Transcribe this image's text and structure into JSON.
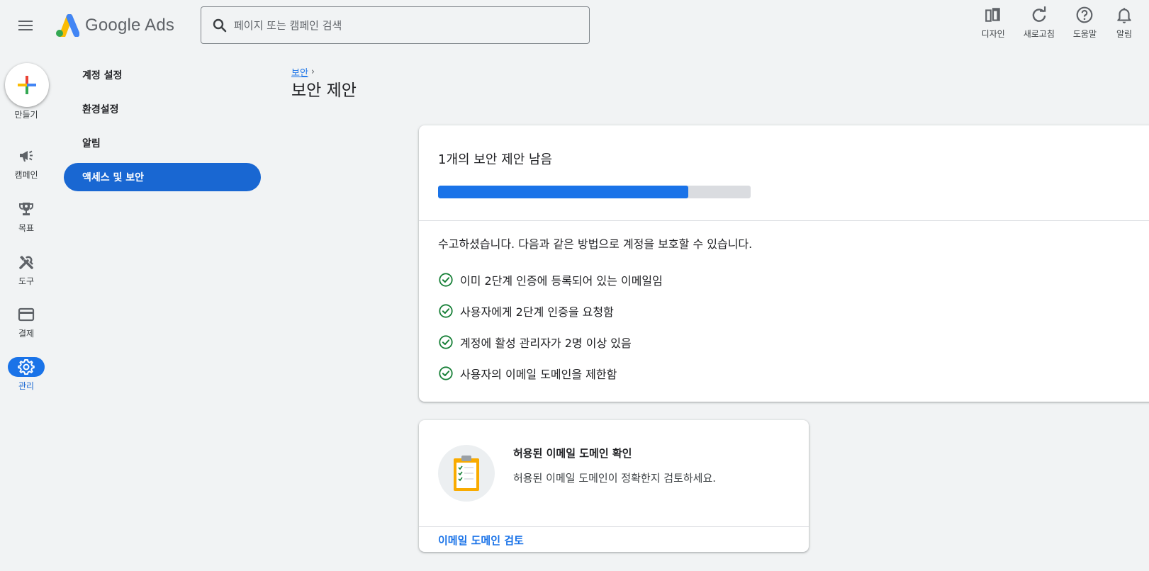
{
  "header": {
    "logo_text": "Google Ads",
    "search_placeholder": "페이지 또는 캠페인 검색",
    "actions": [
      {
        "label": "디자인",
        "icon": "appearance-icon"
      },
      {
        "label": "새로고침",
        "icon": "refresh-icon"
      },
      {
        "label": "도움말",
        "icon": "help-icon"
      },
      {
        "label": "알림",
        "icon": "bell-icon"
      }
    ]
  },
  "rail": {
    "create_label": "만들기",
    "items": [
      {
        "label": "캠페인",
        "icon": "megaphone-icon"
      },
      {
        "label": "목표",
        "icon": "trophy-icon"
      },
      {
        "label": "도구",
        "icon": "tools-icon"
      },
      {
        "label": "결제",
        "icon": "credit-card-icon"
      },
      {
        "label": "관리",
        "icon": "gear-icon",
        "active": true
      }
    ]
  },
  "subnav": {
    "items": [
      {
        "label": "계정 설정"
      },
      {
        "label": "환경설정"
      },
      {
        "label": "알림"
      },
      {
        "label": "액세스 및 보안",
        "active": true
      }
    ]
  },
  "breadcrumb": {
    "parent": "보안",
    "chevron": "›"
  },
  "page_title": "보안 제안",
  "summary_card": {
    "remaining": "1개의 보안 제안 남음",
    "progress_fraction": 0.8,
    "good_job": "수고하셨습니다. 다음과 같은 방법으로 계정을 보호할 수 있습니다.",
    "completed": [
      "이미 2단계 인증에 등록되어 있는 이메일임",
      "사용자에게 2단계 인증을 요청함",
      "계정에 활성 관리자가 2명 이상 있음",
      "사용자의 이메일 도메인을 제한함"
    ]
  },
  "domain_card": {
    "title": "허용된 이메일 도메인 확인",
    "description": "허용된 이메일 도메인이 정확한지 검토하세요.",
    "link": "이메일 도메인 검토"
  },
  "colors": {
    "accent": "#1a73e8",
    "active_nav": "#1967d2",
    "check": "#188038",
    "background": "#f1f3f4"
  }
}
